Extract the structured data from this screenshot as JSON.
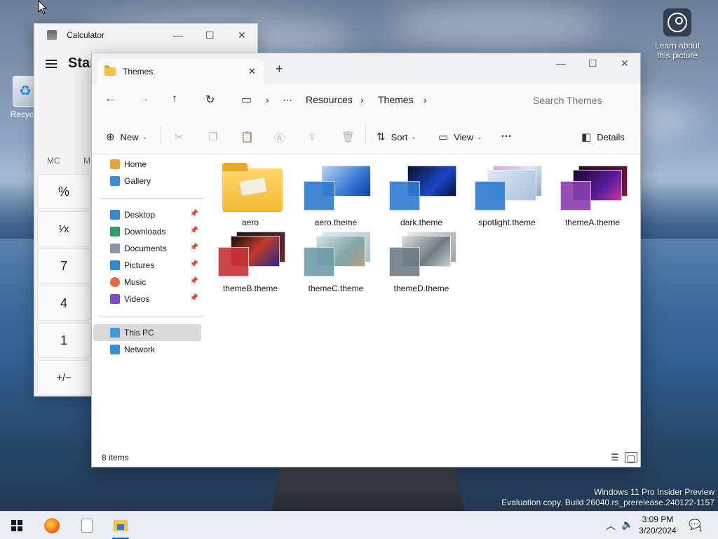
{
  "desktop": {
    "recycle_label": "Recycle",
    "learn_label_1": "Learn about",
    "learn_label_2": "this picture",
    "watermark_1": "Windows 11 Pro Insider Preview",
    "watermark_2": "Evaluation copy. Build 26040.rs_prerelease.240122-1157"
  },
  "calculator": {
    "title": "Calculator",
    "mode": "Star",
    "mem_1": "MC",
    "mem_2": "M",
    "keys": [
      "%",
      "¹⁄x",
      "7",
      "4",
      "1",
      "+/−"
    ]
  },
  "explorer": {
    "tab_title": "Themes",
    "new_tab": "+",
    "breadcrumb": [
      "Resources",
      "Themes"
    ],
    "search_placeholder": "Search Themes",
    "commands": {
      "new": "New",
      "sort": "Sort",
      "view": "View",
      "details": "Details"
    },
    "sidebar": {
      "home": "Home",
      "gallery": "Gallery",
      "desktop": "Desktop",
      "downloads": "Downloads",
      "documents": "Documents",
      "pictures": "Pictures",
      "music": "Music",
      "videos": "Videos",
      "this_pc": "This PC",
      "network": "Network"
    },
    "files": [
      {
        "name": "aero"
      },
      {
        "name": "aero.theme"
      },
      {
        "name": "dark.theme"
      },
      {
        "name": "spotlight.theme"
      },
      {
        "name": "themeA.theme"
      },
      {
        "name": "themeB.theme"
      },
      {
        "name": "themeC.theme"
      },
      {
        "name": "themeD.theme"
      }
    ],
    "status": "8 items"
  },
  "taskbar": {
    "time": "3:09 PM",
    "date": "3/20/2024",
    "notification_count": "1"
  },
  "colors": {
    "accent": "#0067c0",
    "folder": "#f3c14e",
    "selected": "#dadada"
  }
}
